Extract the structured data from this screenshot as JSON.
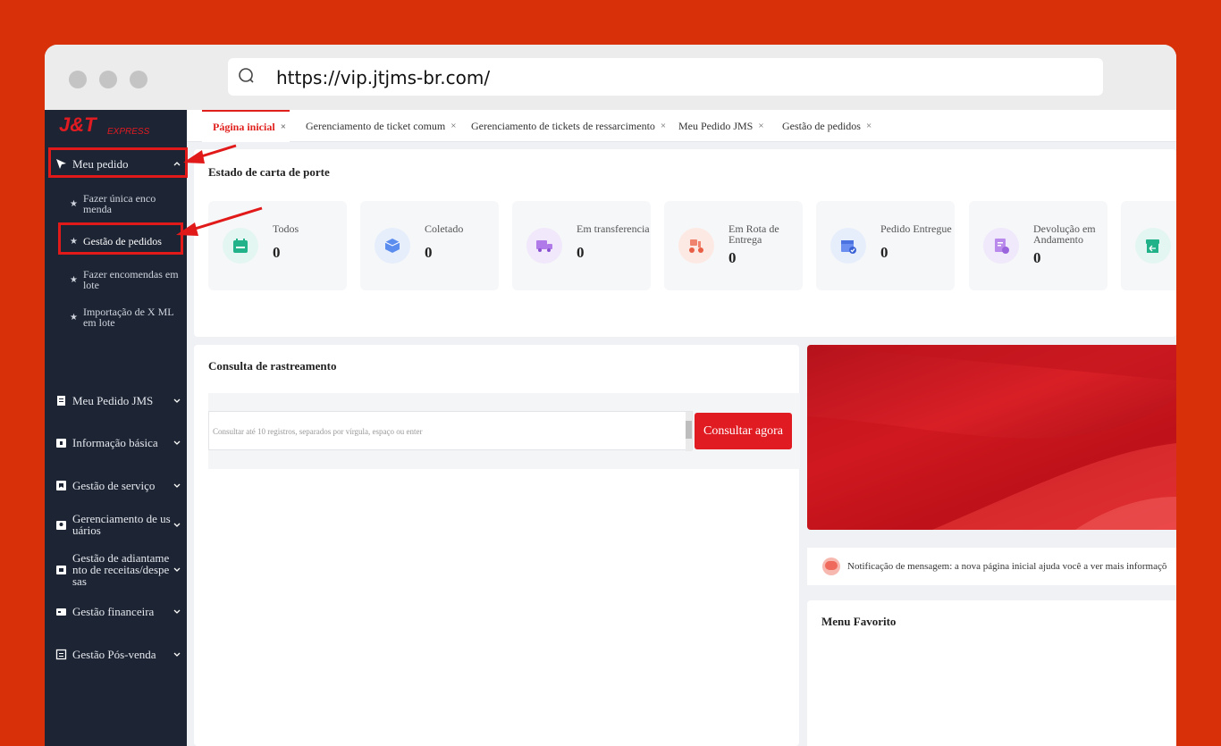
{
  "browser": {
    "url": "https://vip.jtjms-br.com/"
  },
  "logo": {
    "brand": "J&T",
    "sub": "EXPRESS"
  },
  "sidebar": {
    "meu_pedido": "Meu pedido",
    "sub_items": [
      "Fazer única enco menda",
      "Gestão de pedidos",
      "Fazer encomendas em lote",
      "Importação de X ML em lote"
    ],
    "items": [
      "Meu Pedido JMS",
      "Informação básica",
      "Gestão de serviço",
      "Gerenciamento de us uários",
      "Gestão de adiantame nto de receitas/despe sas",
      "Gestão financeira",
      "Gestão Pós-venda"
    ]
  },
  "tabs": [
    "Página inicial",
    "Gerenciamento de ticket comum",
    "Gerenciamento de tickets de ressarcimento",
    "Meu Pedido JMS",
    "Gestão de pedidos"
  ],
  "tab_close": "×",
  "status": {
    "title": "Estado de carta de porte",
    "cards": [
      {
        "label": "Todos",
        "value": "0"
      },
      {
        "label": "Coletado",
        "value": "0"
      },
      {
        "label": "Em transferencia",
        "value": "0"
      },
      {
        "label": "Em Rota de Entrega",
        "value": "0"
      },
      {
        "label": "Pedido Entregue",
        "value": "0"
      },
      {
        "label": "Devolução em Andamento",
        "value": "0"
      }
    ]
  },
  "tracking": {
    "title": "Consulta de rastreamento",
    "placeholder": "Consultar até 10 registros, separados por vírgula, espaço ou enter",
    "button": "Consultar agora"
  },
  "notice": "Notificação de mensagem: a nova página inicial ajuda você a ver mais informaçõ",
  "favorites": {
    "title": "Menu Favorito"
  },
  "colors": {
    "accent": "#e11b22",
    "background": "#d83008",
    "sidebar": "#1d2433",
    "annotation": "#e11919"
  }
}
